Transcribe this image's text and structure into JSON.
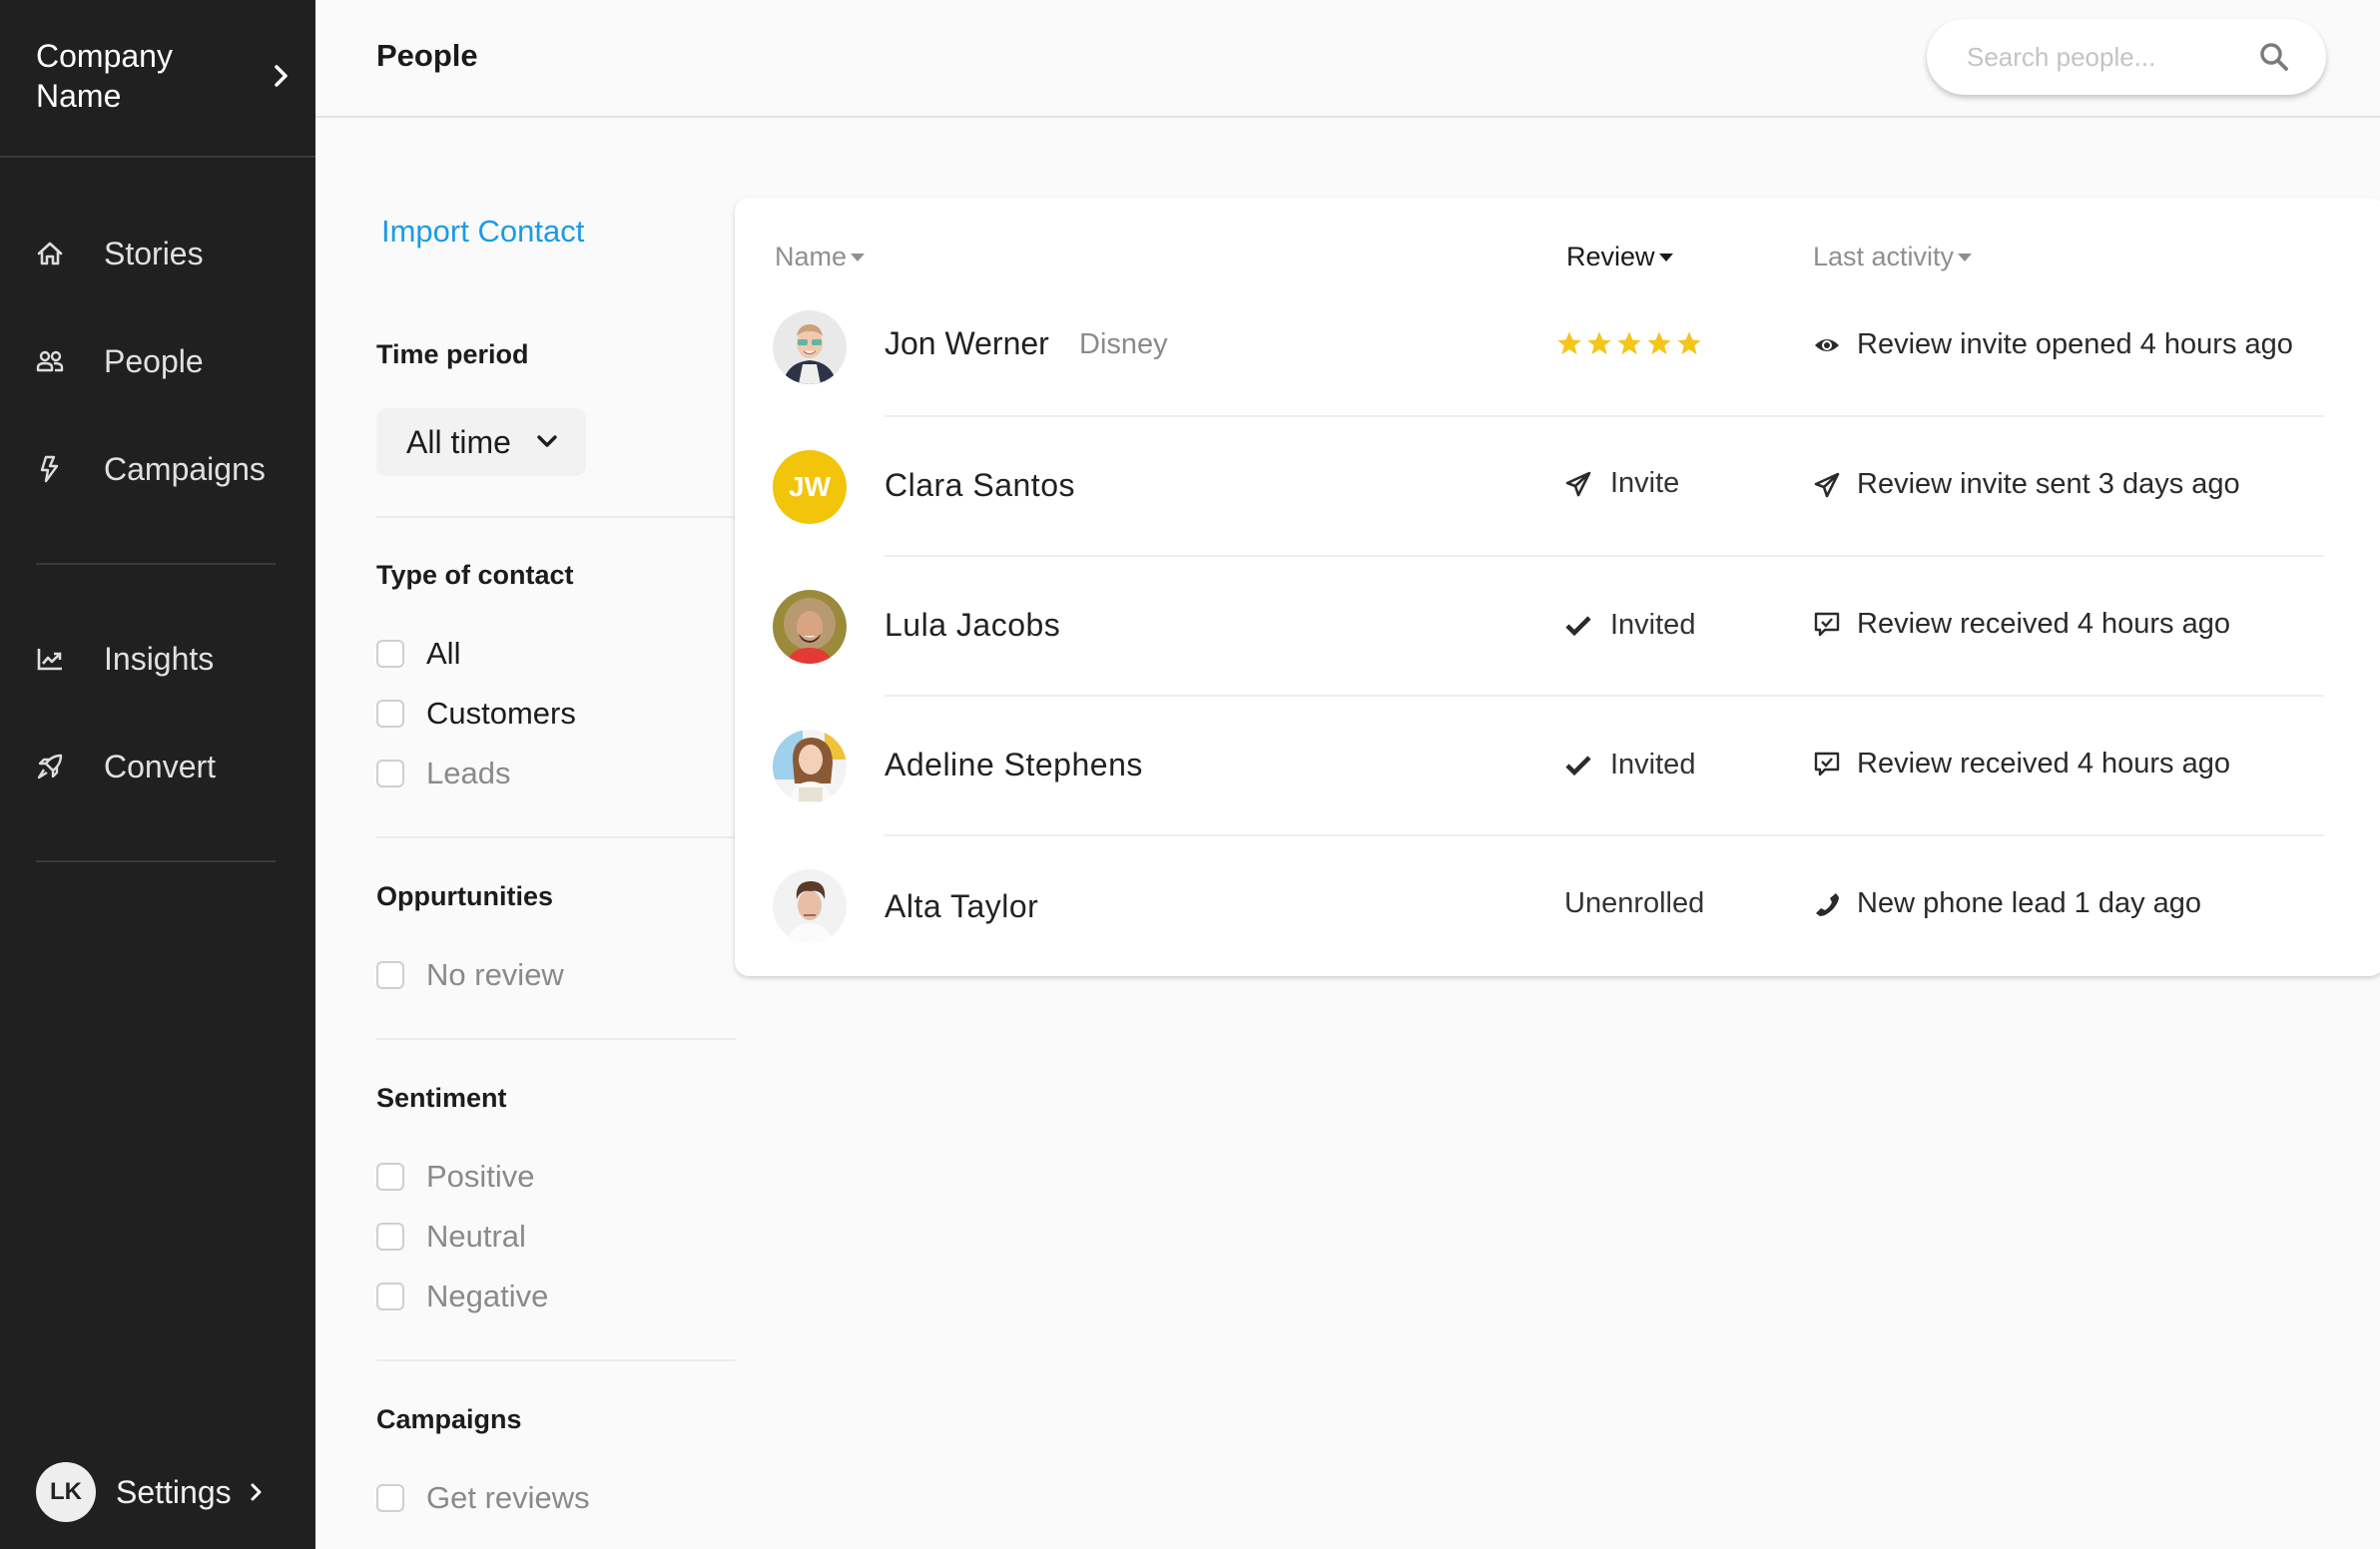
{
  "sidebar": {
    "company_name": "Company Name",
    "nav": [
      {
        "label": "Stories",
        "icon": "home-icon"
      },
      {
        "label": "People",
        "icon": "people-icon"
      },
      {
        "label": "Campaigns",
        "icon": "lightning-icon"
      },
      {
        "label": "Insights",
        "icon": "chart-line-icon"
      },
      {
        "label": "Convert",
        "icon": "rocket-icon"
      }
    ],
    "user_initials": "LK",
    "settings_label": "Settings"
  },
  "header": {
    "title": "People",
    "search_placeholder": "Search people...",
    "search_value": ""
  },
  "filters": {
    "import_label": "Import Contact",
    "time_period": {
      "title": "Time period",
      "selected": "All time"
    },
    "type_of_contact": {
      "title": "Type of contact",
      "options": [
        {
          "label": "All",
          "checked": false
        },
        {
          "label": "Customers",
          "checked": false
        },
        {
          "label": "Leads",
          "checked": false
        }
      ]
    },
    "opportunities": {
      "title": "Oppurtunities",
      "options": [
        {
          "label": "No review",
          "checked": false
        }
      ]
    },
    "sentiment": {
      "title": "Sentiment",
      "options": [
        {
          "label": "Positive",
          "checked": false
        },
        {
          "label": "Neutral",
          "checked": false
        },
        {
          "label": "Negative",
          "checked": false
        }
      ]
    },
    "campaigns": {
      "title": "Campaigns",
      "options": [
        {
          "label": "Get reviews",
          "checked": false
        }
      ]
    }
  },
  "table": {
    "columns": [
      {
        "label": "Name",
        "active": false
      },
      {
        "label": "Review",
        "active": true
      },
      {
        "label": "Last activity",
        "active": false
      }
    ],
    "rows": [
      {
        "name": "Jon Werner",
        "company": "Disney",
        "avatar": "photo",
        "review_type": "stars",
        "rating": 5,
        "rating_max": 5,
        "review_label": "",
        "activity_icon": "eye-icon",
        "activity": "Review invite opened 4 hours ago"
      },
      {
        "name": "Clara Santos",
        "company": "",
        "avatar": "initials",
        "initials": "JW",
        "review_type": "status",
        "review_icon": "paper-plane-icon",
        "review_label": "Invite",
        "activity_icon": "paper-plane-icon",
        "activity": "Review invite sent 3 days ago"
      },
      {
        "name": "Lula Jacobs",
        "company": "",
        "avatar": "photo",
        "review_type": "status",
        "review_icon": "checkmark-icon",
        "review_label": "Invited",
        "activity_icon": "chat-check-icon",
        "activity": "Review received 4 hours ago"
      },
      {
        "name": "Adeline Stephens",
        "company": "",
        "avatar": "photo",
        "review_type": "status",
        "review_icon": "checkmark-icon",
        "review_label": "Invited",
        "activity_icon": "chat-check-icon",
        "activity": "Review received 4 hours ago"
      },
      {
        "name": "Alta Taylor",
        "company": "",
        "avatar": "photo",
        "review_type": "status",
        "review_icon": "",
        "review_label": "Unenrolled",
        "activity_icon": "phone-icon",
        "activity": "New phone lead 1 day ago"
      }
    ]
  },
  "colors": {
    "sidebar_bg": "#202020",
    "accent_link": "#1a9be6",
    "star": "#f5c518",
    "initials_avatar": "#f2c40a"
  }
}
